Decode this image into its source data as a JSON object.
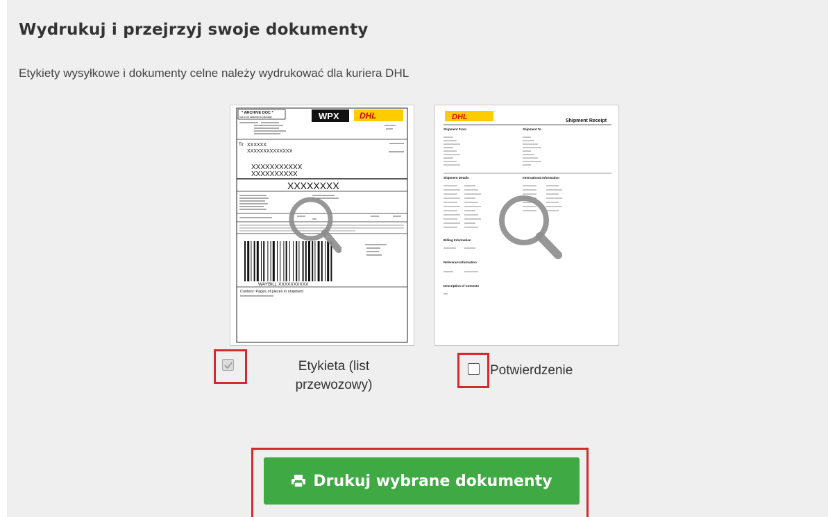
{
  "page": {
    "title": "Wydrukuj i przejrzyj swoje dokumenty",
    "subtitle": "Etykiety wysyłkowe i dokumenty celne należy wydrukować dla kuriera DHL"
  },
  "documents": [
    {
      "name": "Etykieta (list przewozowy)",
      "label_line1": "Etykieta (list",
      "label_line2": "przewozowy)",
      "checked": true,
      "preview_text": {
        "archive": "* ARCHIVE DOC *",
        "archive_sub": "Not to be attached to package",
        "product": "WPX",
        "brand": "DHL",
        "to": "To:",
        "x_short": "XXXXXX",
        "x_mid": "XXXXXXXXXXXXXX",
        "x_big1": "XXXXXXXXXXX",
        "x_big2": "XXXXXXXXXX",
        "x_large": "XXXXXXXX",
        "waybill": "WAYBILL XXXXXXXXXX",
        "content": "Content: Pages of pieces in shipment"
      }
    },
    {
      "name": "Potwierdzenie",
      "label": "Potwierdzenie",
      "checked": false,
      "preview_text": {
        "brand": "DHL",
        "heading": "Shipment Receipt",
        "from": "Shipment From",
        "to": "Shipment To",
        "details": "Shipment Details",
        "intl": "International Information",
        "billing": "Billing Information",
        "reference": "Reference Information",
        "description": "Description of Contents"
      }
    }
  ],
  "actions": {
    "print_label": "Drukuj wybrane dokumenty"
  },
  "colors": {
    "background": "#efefef",
    "button": "#3fa943",
    "highlight": "#d9272e",
    "dhl_yellow": "#ffcc00",
    "dhl_red": "#d40511",
    "magnifier": "#8c8c8c"
  },
  "icons": {
    "print": "printer-icon",
    "preview": "magnifier-icon",
    "check": "checkmark-icon"
  }
}
